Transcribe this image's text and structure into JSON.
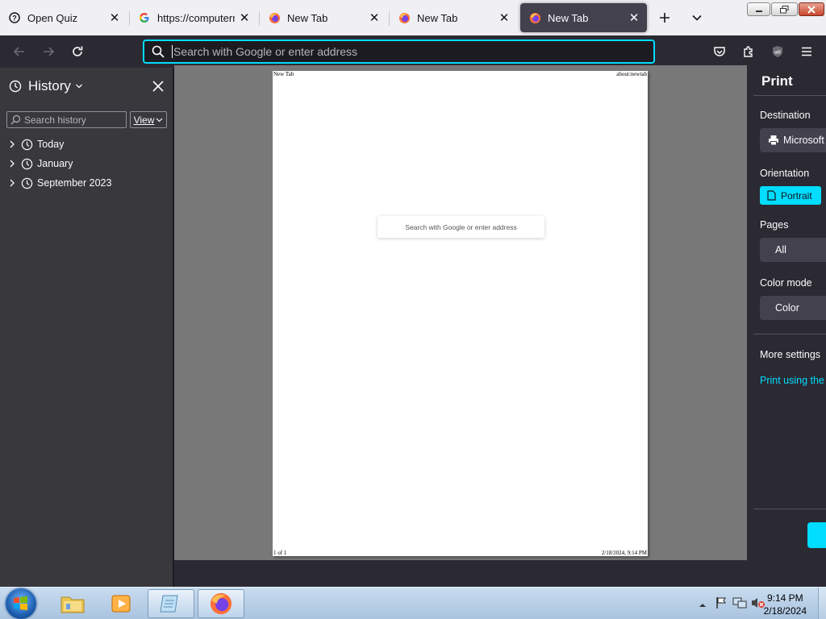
{
  "tabs": [
    {
      "title": "Open Quiz",
      "icon": "help-circle-icon",
      "active": false
    },
    {
      "title": "https://computern",
      "icon": "google-icon",
      "active": false
    },
    {
      "title": "New Tab",
      "icon": "firefox-icon",
      "active": false
    },
    {
      "title": "New Tab",
      "icon": "firefox-icon",
      "active": false
    },
    {
      "title": "New Tab",
      "icon": "firefox-icon",
      "active": true
    }
  ],
  "urlbar": {
    "placeholder": "Search with Google or enter address"
  },
  "sidebar": {
    "title": "History",
    "search_placeholder": "Search history",
    "view_label": "View",
    "items": [
      {
        "label": "Today"
      },
      {
        "label": "January"
      },
      {
        "label": "September 2023"
      }
    ]
  },
  "preview": {
    "header_left": "New Tab",
    "header_right": "about:newtab",
    "search_text": "Search with Google or enter address",
    "footer_left": "1 of 1",
    "footer_right": "2/18/2024, 9:14 PM"
  },
  "print": {
    "title": "Print",
    "destination_label": "Destination",
    "destination_value": "Microsoft",
    "orientation_label": "Orientation",
    "orientation_value": "Portrait",
    "pages_label": "Pages",
    "pages_value": "All",
    "color_mode_label": "Color mode",
    "color_mode_value": "Color",
    "more_settings_label": "More settings",
    "system_dialog_link": "Print using the s"
  },
  "taskbar": {
    "time": "9:14 PM",
    "date": "2/18/2024"
  },
  "colors": {
    "accent": "#00ddff",
    "toolbar": "#2b2a33",
    "sidebar": "#38383d",
    "active_tab": "#42414d"
  }
}
